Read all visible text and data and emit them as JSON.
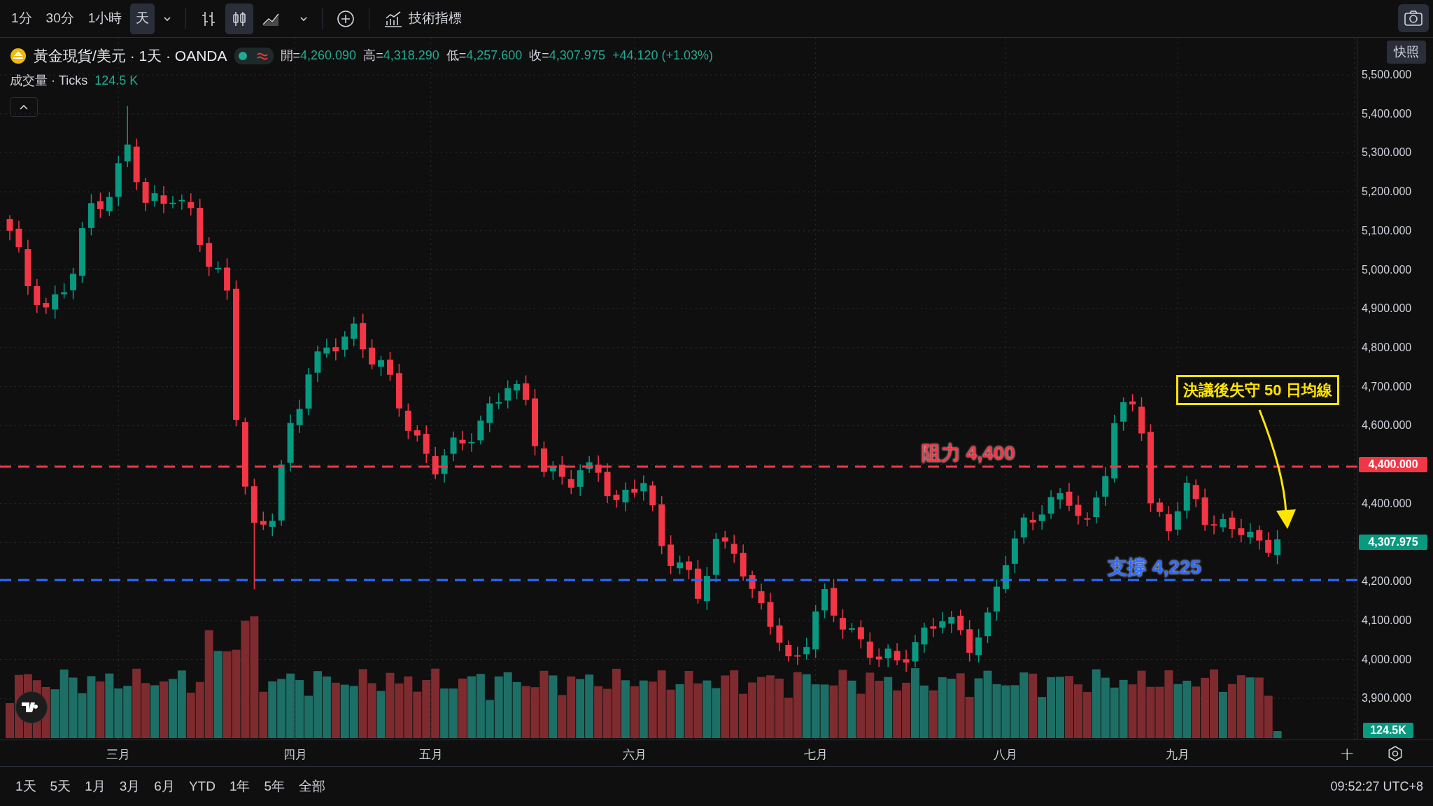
{
  "toolbar": {
    "intervals": [
      {
        "label": "1分",
        "selected": false
      },
      {
        "label": "30分",
        "selected": false
      },
      {
        "label": "1小時",
        "selected": false
      },
      {
        "label": "天",
        "selected": true
      }
    ],
    "chart_styles": [
      {
        "kind": "bars",
        "selected": false
      },
      {
        "kind": "candles",
        "selected": true
      },
      {
        "kind": "area",
        "selected": false
      }
    ],
    "indicators_button": "技術指標",
    "snapshot_tooltip": "快照"
  },
  "legend": {
    "symbol": "黃金現貨/美元 · 1天 · OANDA",
    "ohlc": [
      {
        "label": "開=",
        "value": "4,260.090"
      },
      {
        "label": "高=",
        "value": "4,318.290"
      },
      {
        "label": "低=",
        "value": "4,257.600"
      },
      {
        "label": "收=",
        "value": "4,307.975"
      }
    ],
    "change": "+44.120 (+1.03%)",
    "volume_name": "成交量 · Ticks",
    "volume_value": "124.5 K"
  },
  "annotations": [
    {
      "text": "阻力 4,400",
      "color": "#f23645"
    },
    {
      "text": "支撐 4,225",
      "color": "#2f6bff"
    }
  ],
  "callout": {
    "text": "決議後失守 50 日均線"
  },
  "price_axis": [
    {
      "text": "5,500.000",
      "kind": "tick"
    },
    {
      "text": "5,400.000",
      "kind": "tick"
    },
    {
      "text": "5,300.000",
      "kind": "tick"
    },
    {
      "text": "5,200.000",
      "kind": "tick"
    },
    {
      "text": "5,100.000",
      "kind": "tick"
    },
    {
      "text": "5,000.000",
      "kind": "tick"
    },
    {
      "text": "4,900.000",
      "kind": "tick"
    },
    {
      "text": "4,800.000",
      "kind": "tick"
    },
    {
      "text": "4,700.000",
      "kind": "tick"
    },
    {
      "text": "4,600.000",
      "kind": "tick"
    },
    {
      "text": "4,400.000",
      "kind": "marker",
      "color": "#f23645"
    },
    {
      "text": "4,400.000",
      "kind": "tick"
    },
    {
      "text": "4,307.975",
      "kind": "marker",
      "color": "#089981"
    },
    {
      "text": "4,200.000",
      "kind": "tick"
    },
    {
      "text": "4,100.000",
      "kind": "tick"
    },
    {
      "text": "4,000.000",
      "kind": "tick"
    },
    {
      "text": "3,900.000",
      "kind": "tick"
    }
  ],
  "volume_marker": "124.5K",
  "time_axis": [
    "三月",
    "四月",
    "五月",
    "六月",
    "七月",
    "八月",
    "九月",
    "十"
  ],
  "range_buttons": [
    "1天",
    "5天",
    "1月",
    "3月",
    "6月",
    "YTD",
    "1年",
    "5年",
    "全部"
  ],
  "clock": "09:52:27 UTC+8"
}
